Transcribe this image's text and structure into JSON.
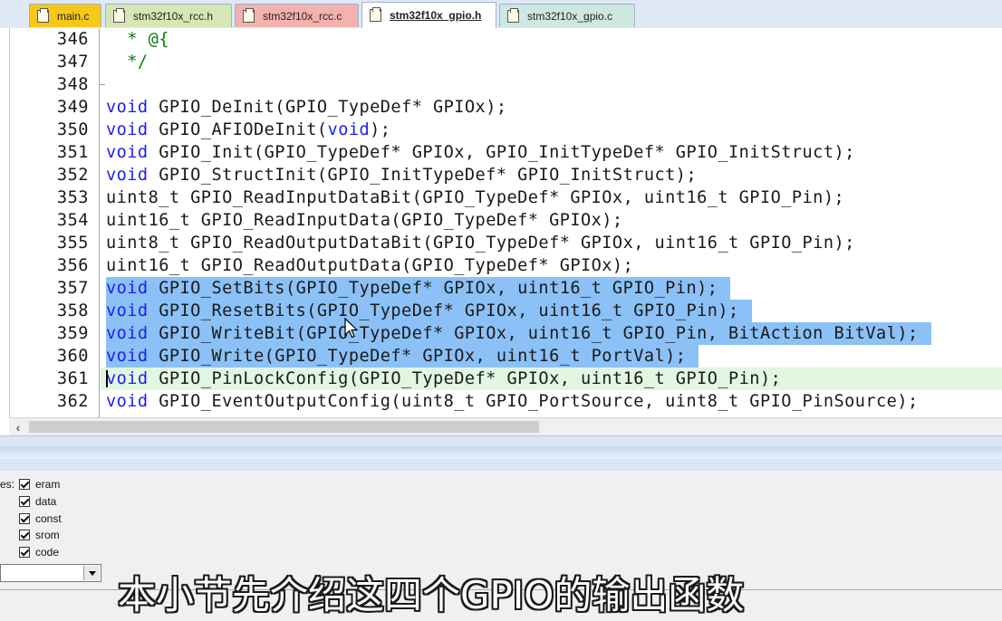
{
  "tabs": [
    {
      "label": "main.c",
      "color": "#f6c81a"
    },
    {
      "label": "stm32f10x_rcc.h",
      "color": "#d6e7b5"
    },
    {
      "label": "stm32f10x_rcc.c",
      "color": "#f3b2ad"
    },
    {
      "label": "stm32f10x_gpio.h",
      "color": "#ffffff",
      "active": true
    },
    {
      "label": "stm32f10x_gpio.c",
      "color": "#cfe7e1"
    }
  ],
  "editor": {
    "lines": [
      {
        "num": "346",
        "text": "  * @{",
        "type": "comment"
      },
      {
        "num": "347",
        "text": "  */",
        "type": "comment"
      },
      {
        "num": "348",
        "text": "",
        "type": "plain"
      },
      {
        "num": "349",
        "kw": "void",
        "text": " GPIO_DeInit(GPIO_TypeDef* GPIOx);",
        "type": "decl"
      },
      {
        "num": "350",
        "kw": "void",
        "text": " GPIO_AFIODeInit(",
        "kw2": "void",
        "tail": ");",
        "type": "decl2"
      },
      {
        "num": "351",
        "kw": "void",
        "text": " GPIO_Init(GPIO_TypeDef* GPIOx, GPIO_InitTypeDef* GPIO_InitStruct);",
        "type": "decl"
      },
      {
        "num": "352",
        "kw": "void",
        "text": " GPIO_StructInit(GPIO_InitTypeDef* GPIO_InitStruct);",
        "type": "decl"
      },
      {
        "num": "353",
        "text": "uint8_t GPIO_ReadInputDataBit(GPIO_TypeDef* GPIOx, uint16_t GPIO_Pin);",
        "type": "plain"
      },
      {
        "num": "354",
        "text": "uint16_t GPIO_ReadInputData(GPIO_TypeDef* GPIOx);",
        "type": "plain"
      },
      {
        "num": "355",
        "text": "uint8_t GPIO_ReadOutputDataBit(GPIO_TypeDef* GPIOx, uint16_t GPIO_Pin);",
        "type": "plain"
      },
      {
        "num": "356",
        "text": "uint16_t GPIO_ReadOutputData(GPIO_TypeDef* GPIOx);",
        "type": "plain"
      },
      {
        "num": "357",
        "kw": "void",
        "text": " GPIO_SetBits(GPIO_TypeDef* GPIOx, uint16_t GPIO_Pin);",
        "type": "decl",
        "selected": true
      },
      {
        "num": "358",
        "kw": "void",
        "text": " GPIO_ResetBits(GPIO_TypeDef* GPIOx, uint16_t GPIO_Pin);",
        "type": "decl",
        "selected": true
      },
      {
        "num": "359",
        "kw": "void",
        "text": " GPIO_WriteBit(GPIO_TypeDef* GPIOx, uint16_t GPIO_Pin, BitAction BitVal);",
        "type": "decl",
        "selected": true
      },
      {
        "num": "360",
        "kw": "void",
        "text": " GPIO_Write(GPIO_TypeDef* GPIOx, uint16_t PortVal);",
        "type": "decl",
        "selected": true
      },
      {
        "num": "361",
        "kw": "void",
        "text": " GPIO_PinLockConfig(GPIO_TypeDef* GPIOx, uint16_t GPIO_Pin);",
        "type": "decl",
        "current": true
      },
      {
        "num": "362",
        "kw": "void",
        "text": " GPIO_EventOutputConfig(uint8_t GPIO_PortSource, uint8_t GPIO_PinSource);",
        "type": "decl"
      }
    ]
  },
  "panel": {
    "label": "es:",
    "checkboxes": [
      "eram",
      "data",
      "const",
      "srom",
      "code"
    ]
  },
  "subtitle": "本小节先介绍这四个GPIO的输出函数",
  "colors": {
    "selection": "#8bc1f7",
    "current_line": "#e2f7e2",
    "keyword": "#1e1ef0",
    "comment": "#0a7f0a"
  }
}
